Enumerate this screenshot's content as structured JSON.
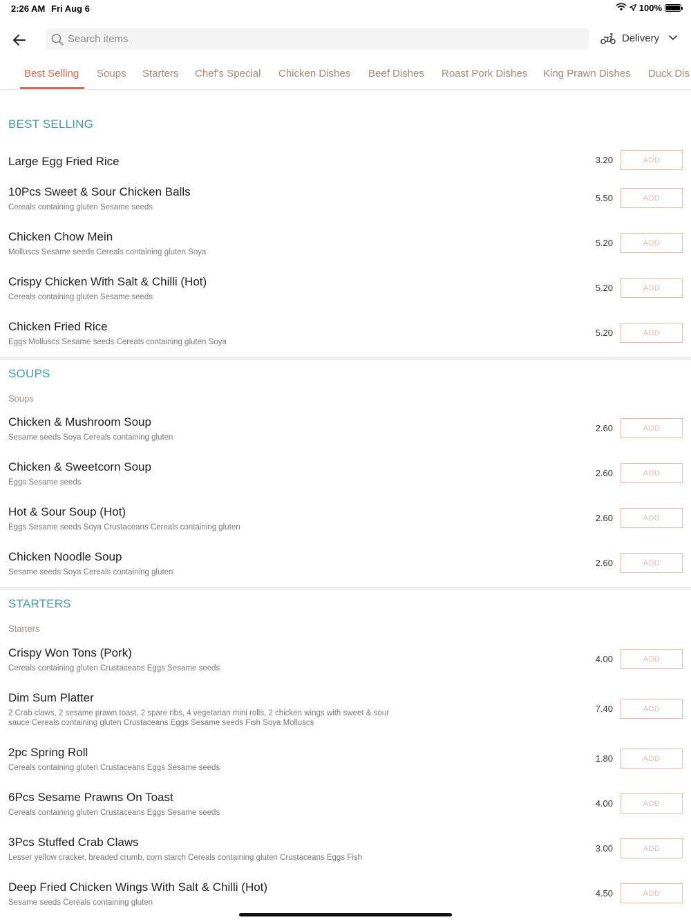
{
  "status": {
    "time": "2:26 AM",
    "date": "Fri Aug 6",
    "battery": "100%",
    "battery_level": 1.0
  },
  "header": {
    "search_placeholder": "Search items",
    "delivery_label": "Delivery"
  },
  "tabs": [
    "Best Selling",
    "Soups",
    "Starters",
    "Chef's Special",
    "Chicken Dishes",
    "Beef Dishes",
    "Roast Pork Dishes",
    "King Prawn Dishes",
    "Duck Dis"
  ],
  "add_label": "ADD",
  "sections": {
    "best": {
      "title": "BEST SELLING",
      "items": [
        {
          "name": "Large Egg Fried Rice",
          "desc": "",
          "price": "3.20"
        },
        {
          "name": "10Pcs Sweet & Sour Chicken Balls",
          "desc": "Cereals containing gluten  Sesame seeds",
          "price": "5.50"
        },
        {
          "name": "Chicken Chow Mein",
          "desc": "Molluscs  Sesame seeds  Cereals containing gluten  Soya",
          "price": "5.20"
        },
        {
          "name": "Crispy Chicken With Salt & Chilli (Hot)",
          "desc": "Cereals containing gluten  Sesame seeds",
          "price": "5.20"
        },
        {
          "name": "Chicken Fried Rice",
          "desc": "Eggs  Molluscs  Sesame seeds  Cereals containing gluten  Soya",
          "price": "5.20"
        }
      ]
    },
    "soups": {
      "title": "SOUPS",
      "subtitle": "Soups",
      "items": [
        {
          "name": "Chicken & Mushroom Soup",
          "desc": "Sesame seeds  Soya  Cereals containing gluten",
          "price": "2.60"
        },
        {
          "name": "Chicken & Sweetcorn Soup",
          "desc": "Eggs  Sesame seeds",
          "price": "2.60"
        },
        {
          "name": "Hot & Sour Soup (Hot)",
          "desc": "Eggs  Sesame seeds  Soya  Crustaceans  Cereals containing gluten",
          "price": "2.60"
        },
        {
          "name": "Chicken Noodle Soup",
          "desc": "Sesame seeds  Soya  Cereals containing gluten",
          "price": "2.60"
        }
      ]
    },
    "starters": {
      "title": "STARTERS",
      "subtitle": "Starters",
      "items": [
        {
          "name": "Crispy Won Tons (Pork)",
          "desc": "Cereals containing gluten  Crustaceans  Eggs  Sesame seeds",
          "price": "4.00"
        },
        {
          "name": "Dim Sum Platter",
          "desc": "2 Crab claws, 2 sesame prawn toast, 2 spare ribs, 4 vegetarian mini rolls, 2 chicken wings with sweet & sour sauce  Cereals containing gluten  Crustaceans  Eggs  Sesame seeds  Fish  Soya  Molluscs",
          "price": "7.40"
        },
        {
          "name": "2pc Spring Roll",
          "desc": "Cereals containing gluten  Crustaceans  Eggs  Sesame seeds",
          "price": "1.80"
        },
        {
          "name": "6Pcs Sesame Prawns On Toast",
          "desc": "Cereals containing gluten  Crustaceans  Eggs  Sesame seeds",
          "price": "4.00"
        },
        {
          "name": "3Pcs Stuffed Crab Claws",
          "desc": "Lesser yellow cracker, breaded crumb, corn starch  Cereals containing gluten  Crustaceans  Eggs  Fish",
          "price": "3.00"
        },
        {
          "name": "Deep Fried Chicken Wings With Salt & Chilli (Hot)",
          "desc": "Sesame seeds  Cereals containing gluten",
          "price": "4.50"
        }
      ]
    }
  },
  "colors": {
    "accent": "#d36a52",
    "section_title": "#3f9ca9",
    "tab_text": "#a08a79",
    "add_border": "#eab8ab"
  }
}
